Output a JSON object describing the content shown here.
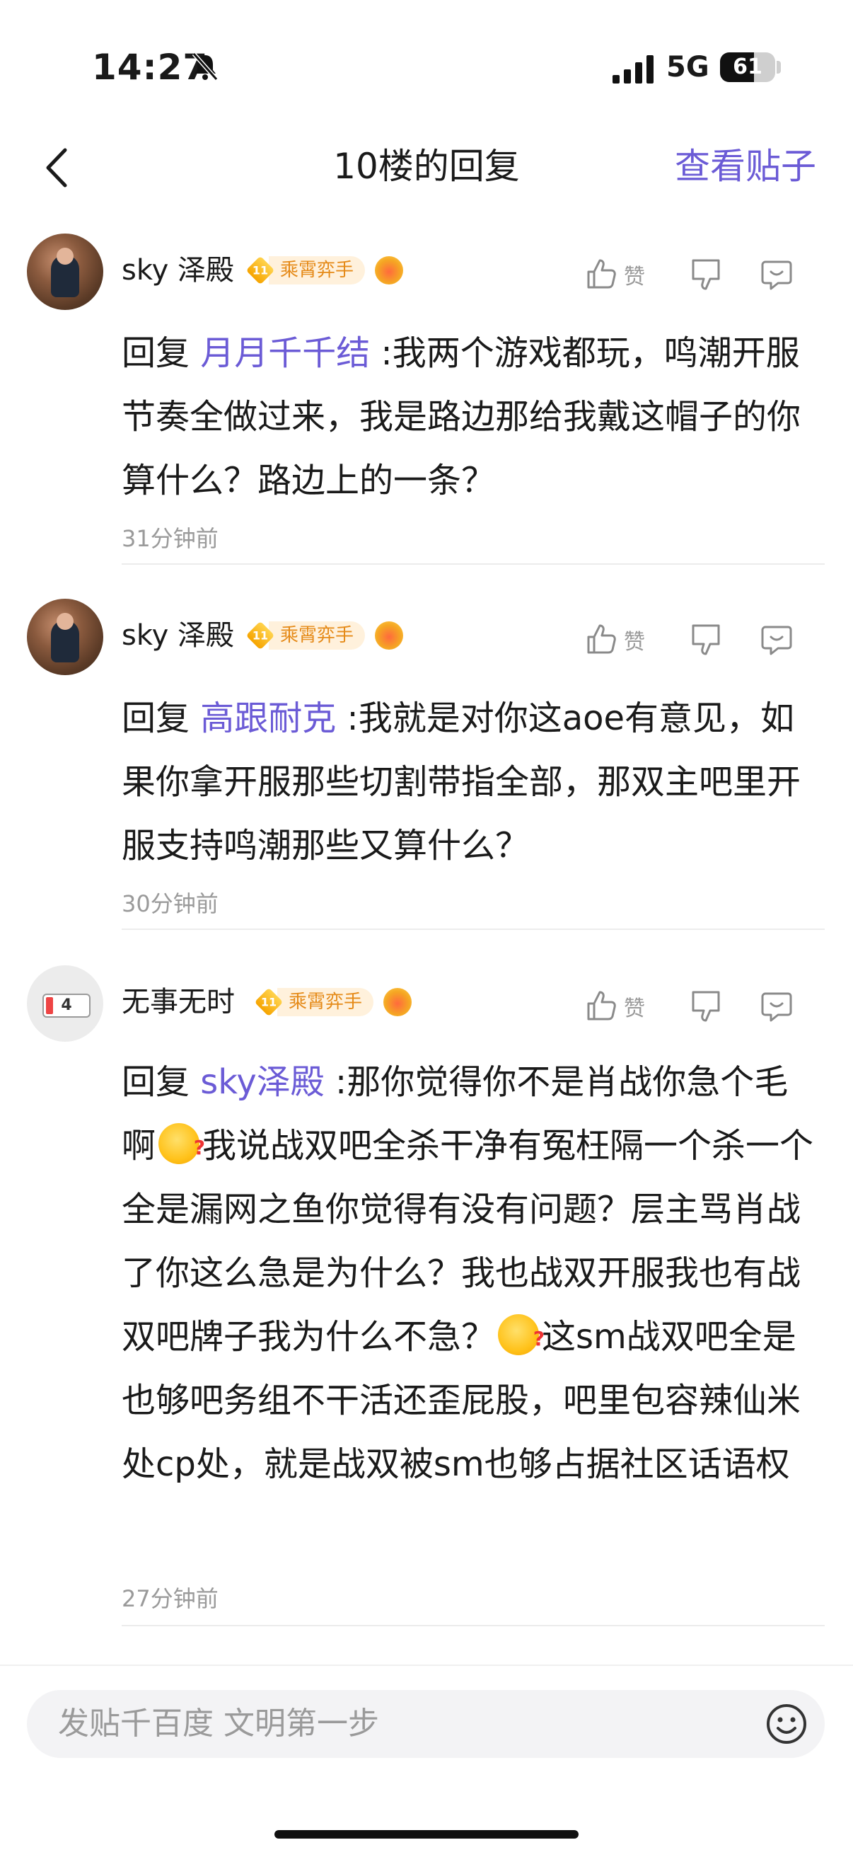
{
  "status_bar": {
    "time": "14:27",
    "network": "5G",
    "battery": "61",
    "battery_level": 0.61
  },
  "header": {
    "title": "10楼的回复",
    "view_post": "查看贴子"
  },
  "like_label": "赞",
  "comments": [
    {
      "name": "sky 泽殿",
      "level": "11",
      "title_tag": "乘霄弈手",
      "reply_prefix": "回复 ",
      "mention": "月月千千结",
      "text": " :我两个游戏都玩，鸣潮开服节奏全做过来，我是路边那给我戴这帽子的你算什么？路边上的一条？",
      "time": "31分钟前"
    },
    {
      "name": "sky 泽殿",
      "level": "11",
      "title_tag": "乘霄弈手",
      "reply_prefix": "回复 ",
      "mention": "高跟耐克",
      "text": " :我就是对你这aoe有意见，如果你拿开服那些切割带指全部，那双主吧里开服支持鸣潮那些又算什么？",
      "time": "30分钟前"
    },
    {
      "name": "无事无时",
      "avatar_badge": "4",
      "level": "11",
      "title_tag": "乘霄弈手",
      "reply_prefix": "回复 ",
      "mention": "sky泽殿",
      "text_a": " :那你觉得你不是肖战你急个毛啊",
      "text_b": "我说战双吧全杀干净有冤枉隔一个杀一个全是漏网之鱼你觉得有没有问题？层主骂肖战了你这么急是为什么？我也战双开服我也有战双吧牌子我为什么不急？",
      "text_c": "这sm战双吧全是也够吧务组不干活还歪屁股，吧里包容辣仙米处cp处，就是战双被sm也够占据社区话语权",
      "time": "27分钟前"
    }
  ],
  "bottom_bar": {
    "placeholder": "发贴千百度 文明第一步"
  }
}
